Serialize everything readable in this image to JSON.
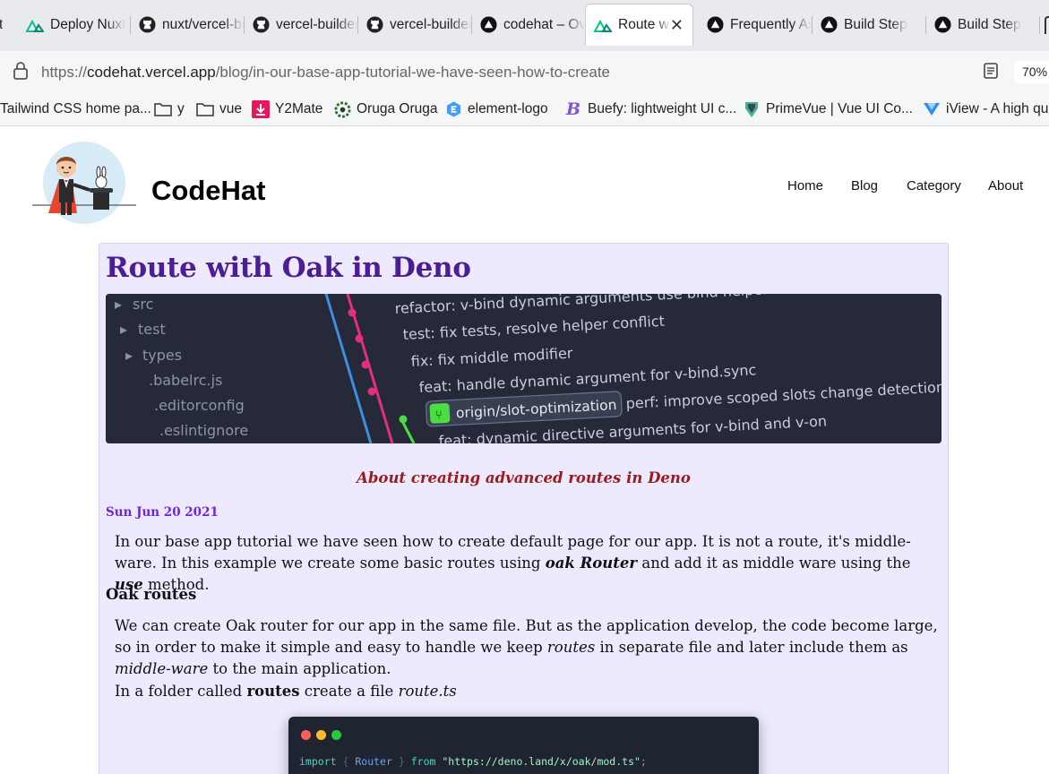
{
  "browser": {
    "tabs": [
      {
        "label": "Deploy Nuxt",
        "icon": "nuxt-icon"
      },
      {
        "label": "nuxt/vercel-builder",
        "icon": "github-icon"
      },
      {
        "label": "vercel-builder",
        "icon": "github-icon"
      },
      {
        "label": "vercel-builder",
        "icon": "github-icon"
      },
      {
        "label": "codehat – Overview",
        "icon": "vercel-icon"
      },
      {
        "label": "Route with Oak",
        "icon": "nuxt-icon",
        "active": true
      },
      {
        "label": "Frequently Asked",
        "icon": "vercel-icon"
      },
      {
        "label": "Build Step",
        "icon": "vercel-icon"
      },
      {
        "label": "Build Step",
        "icon": "vercel-icon"
      }
    ],
    "first_tab_fragment": "t",
    "close_symbol": "✕",
    "url_scheme": "https://",
    "url_host": "codehat.vercel.app",
    "url_path": "/blog/in-our-base-app-tutorial-we-have-seen-how-to-create",
    "zoom": "70%",
    "bookmarks": [
      {
        "label": "Tailwind CSS home pa...",
        "icon": "none"
      },
      {
        "label": "y",
        "icon": "folder-icon"
      },
      {
        "label": "vue",
        "icon": "folder-icon"
      },
      {
        "label": "Y2Mate",
        "icon": "download-icon"
      },
      {
        "label": "Oruga Oruga",
        "icon": "oruga-icon"
      },
      {
        "label": "element-logo",
        "icon": "element-icon"
      },
      {
        "label": "Buefy: lightweight UI c...",
        "icon": "buefy-icon"
      },
      {
        "label": "PrimeVue | Vue UI Co...",
        "icon": "primevue-icon"
      },
      {
        "label": "iView - A high qu",
        "icon": "iview-icon"
      }
    ]
  },
  "site": {
    "name": "CodeHat",
    "nav": [
      "Home",
      "Blog",
      "Category",
      "About"
    ]
  },
  "post": {
    "title": "Route with Oak in Deno",
    "hero_lines": {
      "tree": [
        "src",
        "test",
        "types",
        ".babelrc.js",
        ".editorconfig",
        ".eslintignore"
      ],
      "commits": [
        "refactor: v-bind dynamic arguments use bind helper",
        "test: fix tests, resolve helper conflict",
        "fix: fix middle modifier",
        "feat: handle dynamic argument for v-bind.sync",
        "perf: improve scoped slots change detection ac",
        "feat: dynamic directive arguments for v-bind and v-on"
      ],
      "branch": "origin/slot-optimization"
    },
    "subtitle": "About creating advanced routes in Deno",
    "date": "Sun Jun 20 2021",
    "p1": {
      "a": "In our base app tutorial we have seen how to create default page for our app. It is not a route, it's middle-ware. In this example we create some basic routes using ",
      "b": "oak Router",
      "c": " and add it as middle ware using the ",
      "d": "use",
      "e": " method."
    },
    "h_oak": "Oak routes",
    "p2": {
      "a": "We can create Oak router for our app in the same file. But as the application develop, the code become large, so in order to make it simple and easy to handle we keep ",
      "b": "routes",
      "c": " in separate file and later include them as ",
      "d": "middle-ware",
      "e": " to the main application."
    },
    "p3": {
      "a": "In a folder called ",
      "b": "routes",
      "c": " create a file ",
      "d": "route.ts"
    },
    "code": {
      "kw1": "import",
      "brace_open": "{",
      "ident": "Router",
      "brace_close": "}",
      "kw2": "from",
      "str": "\"https://deno.land/x/oak/mod.ts\"",
      "semi": ";"
    }
  },
  "colors": {
    "article_bg": "#ede9fe",
    "title": "#4c1d95",
    "subtitle": "#9b1c1c",
    "date": "#6d28d9"
  }
}
